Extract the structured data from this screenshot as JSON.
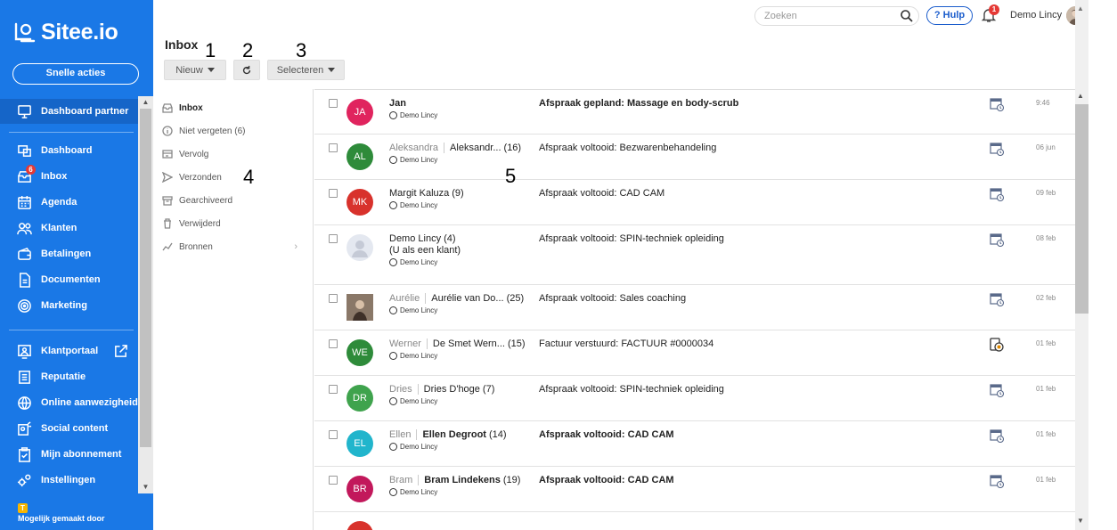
{
  "sidebar": {
    "brand": "Sitee.io",
    "quick_actions": "Snelle acties",
    "items": [
      {
        "label": "Dashboard partner",
        "icon": "monitor-icon"
      },
      {
        "label": "Dashboard",
        "icon": "screens-icon"
      },
      {
        "label": "Inbox",
        "icon": "inbox-icon",
        "badge": "6"
      },
      {
        "label": "Agenda",
        "icon": "calendar-icon"
      },
      {
        "label": "Klanten",
        "icon": "users-icon"
      },
      {
        "label": "Betalingen",
        "icon": "wallet-icon"
      },
      {
        "label": "Documenten",
        "icon": "document-icon"
      },
      {
        "label": "Marketing",
        "icon": "target-icon"
      },
      {
        "label": "Klantportaal",
        "icon": "portal-icon"
      },
      {
        "label": "Reputatie",
        "icon": "list-icon"
      },
      {
        "label": "Online aanwezigheid",
        "icon": "globe-icon"
      },
      {
        "label": "Social content",
        "icon": "social-icon"
      },
      {
        "label": "Mijn abonnement",
        "icon": "clipboard-icon"
      },
      {
        "label": "Instellingen",
        "icon": "gears-icon"
      }
    ],
    "made_by": "Mogelijk gemaakt door",
    "made_by_badge": "T"
  },
  "header": {
    "search_placeholder": "Zoeken",
    "help": "? Hulp",
    "notif_count": "1",
    "user": "Demo Lincy"
  },
  "toolbar": {
    "title": "Inbox",
    "new": "Nieuw",
    "select": "Selecteren",
    "annotations": [
      "1",
      "2",
      "3",
      "4",
      "5"
    ]
  },
  "folders": [
    {
      "label": "Inbox",
      "icon": "inbox-icon"
    },
    {
      "label": "Niet vergeten (6)",
      "icon": "info-icon"
    },
    {
      "label": "Vervolg",
      "icon": "followup-icon"
    },
    {
      "label": "Verzonden",
      "icon": "send-icon"
    },
    {
      "label": "Gearchiveerd",
      "icon": "archive-icon"
    },
    {
      "label": "Verwijderd",
      "icon": "trash-icon"
    },
    {
      "label": "Bronnen",
      "icon": "chart-line-icon",
      "chevron": "›"
    }
  ],
  "messages": [
    {
      "initials": "JA",
      "color": "#e0245e",
      "first": "",
      "name": "Jan",
      "count": "",
      "extra": "",
      "agent": "Demo Lincy",
      "subject": "Afspraak gepland: Massage en body-scrub",
      "unread": true,
      "time": "9:46",
      "icon": "calendar-check-icon"
    },
    {
      "initials": "AL",
      "color": "#2e8b3a",
      "first": "Aleksandra",
      "name": "Aleksandr...",
      "count": "(16)",
      "extra": "",
      "agent": "Demo Lincy",
      "subject": "Afspraak voltooid: Bezwarenbehandeling",
      "unread": false,
      "time": "06 jun",
      "icon": "calendar-check-icon"
    },
    {
      "initials": "MK",
      "color": "#d8322c",
      "first": "",
      "name": "Margit Kaluza",
      "count": "(9)",
      "extra": "",
      "agent": "Demo Lincy",
      "subject": "Afspraak voltooid: CAD CAM",
      "unread": false,
      "time": "09 feb",
      "icon": "calendar-check-icon"
    },
    {
      "initials": "",
      "color": "#e4e8f0",
      "first": "",
      "name": "Demo Lincy",
      "count": "(4)",
      "extra": "(U als een klant)",
      "agent": "Demo Lincy",
      "subject": "Afspraak voltooid: SPIN-techniek opleiding",
      "unread": false,
      "time": "08 feb",
      "icon": "calendar-check-icon"
    },
    {
      "initials": "",
      "color": "#7a6a5a",
      "first": "Aurélie",
      "name": "Aurélie van Do...",
      "count": "(25)",
      "extra": "",
      "agent": "Demo Lincy",
      "subject": "Afspraak voltooid: Sales coaching",
      "unread": false,
      "time": "02 feb",
      "icon": "calendar-check-icon"
    },
    {
      "initials": "WE",
      "color": "#2e8b3a",
      "first": "Werner",
      "name": "De Smet Wern...",
      "count": "(15)",
      "extra": "",
      "agent": "Demo Lincy",
      "subject": "Factuur verstuurd: FACTUUR #0000034",
      "unread": false,
      "time": "01 feb",
      "icon": "invoice-icon"
    },
    {
      "initials": "DR",
      "color": "#3fa34d",
      "first": "Dries",
      "name": "Dries D'hoge",
      "count": "(7)",
      "extra": "",
      "agent": "Demo Lincy",
      "subject": "Afspraak voltooid: SPIN-techniek opleiding",
      "unread": false,
      "time": "01 feb",
      "icon": "calendar-check-icon"
    },
    {
      "initials": "EL",
      "color": "#21b5cc",
      "first": "Ellen",
      "name": "Ellen Degroot",
      "count": "(14)",
      "extra": "",
      "agent": "Demo Lincy",
      "subject": "Afspraak voltooid: CAD CAM",
      "unread": true,
      "time": "01 feb",
      "icon": "calendar-check-icon"
    },
    {
      "initials": "BR",
      "color": "#c2185b",
      "first": "Bram",
      "name": "Bram Lindekens",
      "count": "(19)",
      "extra": "",
      "agent": "Demo Lincy",
      "subject": "Afspraak voltooid: CAD CAM",
      "unread": true,
      "time": "01 feb",
      "icon": "calendar-check-icon"
    }
  ]
}
